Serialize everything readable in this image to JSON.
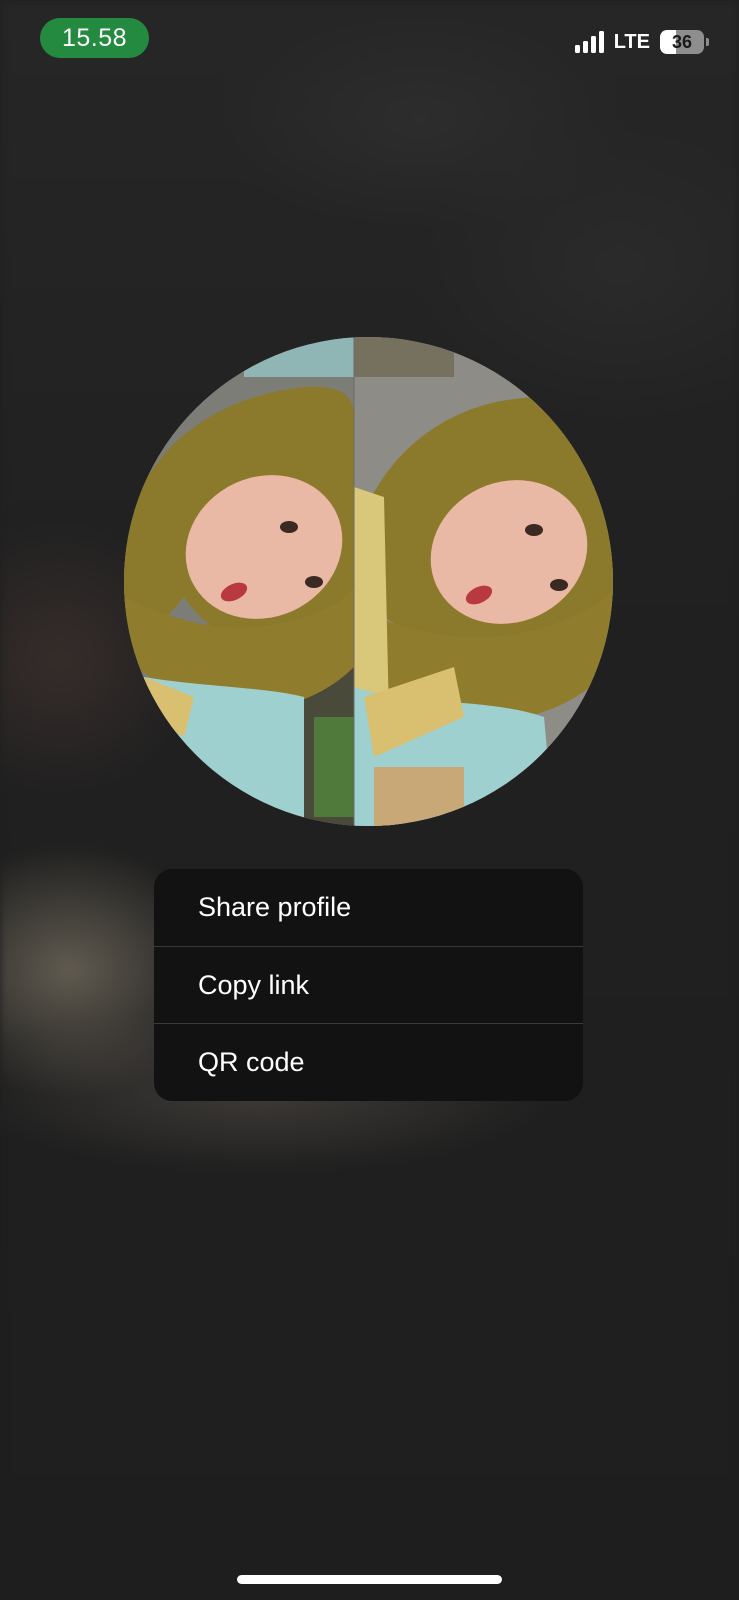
{
  "status_bar": {
    "time": "15.58",
    "network": "LTE",
    "battery_level": "36",
    "battery_fraction": 0.36,
    "signal_bars": 4,
    "time_pill_color": "#238a3f"
  },
  "avatar": {
    "icon": "profile-photo"
  },
  "menu": {
    "items": [
      {
        "label": "Share profile"
      },
      {
        "label": "Copy link"
      },
      {
        "label": "QR code"
      }
    ]
  },
  "colors": {
    "background": "#1f1f1f",
    "menu_background": "#121212",
    "separator": "#3a3a3a"
  }
}
